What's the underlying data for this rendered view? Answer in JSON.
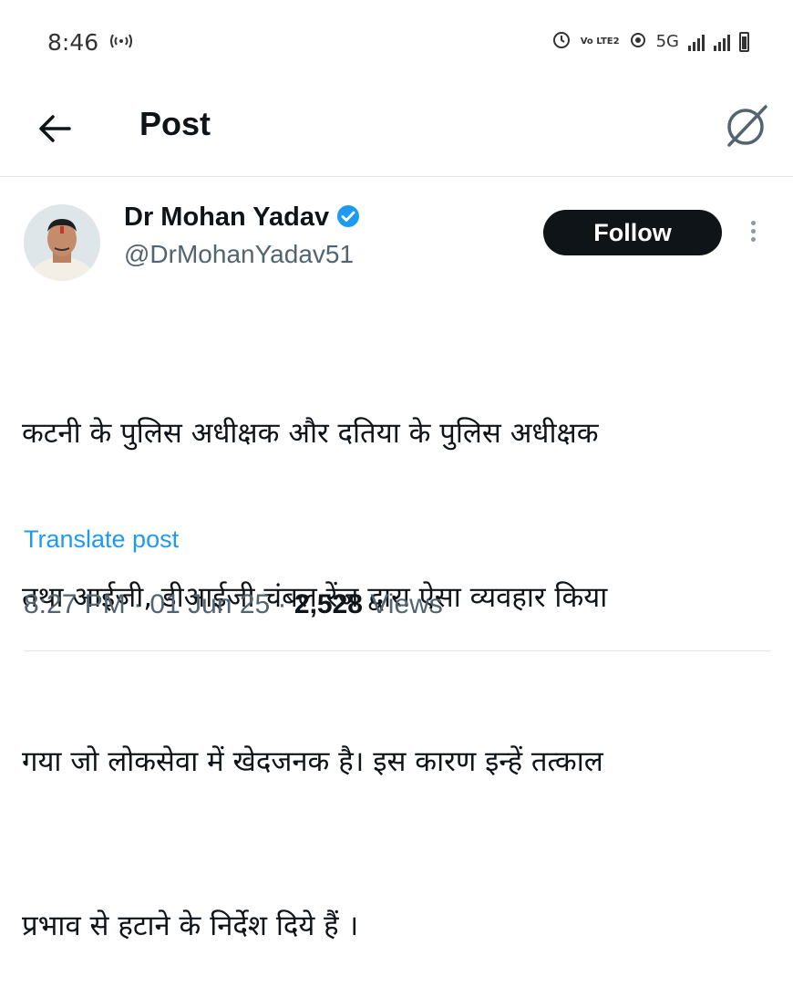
{
  "status_bar": {
    "time": "8:46",
    "hotspot_icon": "hotspot-icon",
    "alarm_icon": "alarm-icon",
    "volte_label": "Vo LTE2",
    "wifi_icon": "wifi-icon",
    "network_type": "5G",
    "battery_icon": "battery-icon"
  },
  "app_bar": {
    "title": "Post",
    "back_icon": "back-arrow-icon",
    "grok_icon": "grok-icon"
  },
  "post": {
    "author_name": "Dr Mohan Yadav",
    "verified_icon": "verified-badge-icon",
    "handle": "@DrMohanYadav51",
    "follow_label": "Follow",
    "more_icon": "more-options-icon",
    "text_lines": [
      "कटनी के पुलिस अधीक्षक और दतिया के पुलिस अधीक्षक",
      "तथा आईजी, डीआईजी चंबल रेंज द्वारा ऐसा व्यवहार किया",
      "गया जो लोकसेवा में खेदजनक है। इस कारण इन्हें तत्काल",
      "प्रभाव से हटाने के निर्देश दिये हैं ।"
    ],
    "translate_label": "Translate post",
    "time": "8:27 PM",
    "date": "01 Jun 25",
    "views_count": "2,528",
    "views_label": "Views",
    "separator": "·"
  },
  "colors": {
    "accent": "#1d9bf0",
    "text_primary": "#0f1419",
    "text_secondary": "#536471",
    "follow_bg": "#0f1419"
  }
}
